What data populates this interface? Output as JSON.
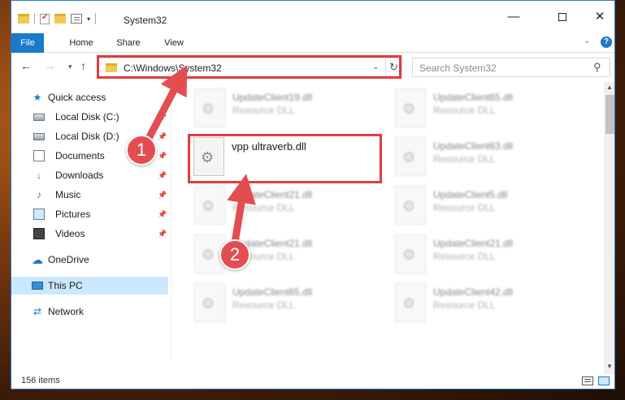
{
  "window": {
    "title": "System32",
    "buttons": {
      "minimize": "—",
      "maximize": "",
      "close": "✕"
    }
  },
  "ribbon": {
    "tabs": [
      "File",
      "Home",
      "Share",
      "View"
    ],
    "expand": "⌄",
    "help": "?"
  },
  "nav": {
    "back": "←",
    "forward": "→",
    "recent": "▾",
    "up": "↑",
    "address": "C:\\Windows\\System32",
    "address_dropdown": "⌄",
    "refresh": "↻",
    "search_placeholder": "Search System32",
    "search_icon": "⚲"
  },
  "sidebar": {
    "items": [
      {
        "label": "Quick access",
        "icon": "star-icon",
        "glyph": "★",
        "pinned": false
      },
      {
        "label": "Local Disk (C:)",
        "icon": "drive-icon",
        "glyph": "",
        "pinned": true
      },
      {
        "label": "Local Disk (D:)",
        "icon": "drive-icon",
        "glyph": "",
        "pinned": true
      },
      {
        "label": "Documents",
        "icon": "document-icon",
        "glyph": "",
        "pinned": true
      },
      {
        "label": "Downloads",
        "icon": "download-icon",
        "glyph": "↓",
        "pinned": true
      },
      {
        "label": "Music",
        "icon": "music-icon",
        "glyph": "♪",
        "pinned": true
      },
      {
        "label": "Pictures",
        "icon": "pictures-icon",
        "glyph": "",
        "pinned": true
      },
      {
        "label": "Videos",
        "icon": "video-icon",
        "glyph": "",
        "pinned": true
      },
      {
        "label": "OneDrive",
        "icon": "cloud-icon",
        "glyph": "☁",
        "pinned": false
      },
      {
        "label": "This PC",
        "icon": "computer-icon",
        "glyph": "",
        "pinned": false
      },
      {
        "label": "Network",
        "icon": "network-icon",
        "glyph": "⇄",
        "pinned": false
      }
    ],
    "pin_glyph": "📌"
  },
  "files": [
    {
      "name": "UpdateClient19.dll",
      "type": "Resource DLL"
    },
    {
      "name": "UpdateClient65.dll",
      "type": "Resource DLL"
    },
    {
      "name": "vpp ultraverb.dll",
      "type": ""
    },
    {
      "name": "UpdateClient63.dll",
      "type": "Resource DLL"
    },
    {
      "name": "UpdateClient21.dll",
      "type": "Resource DLL"
    },
    {
      "name": "UpdateClient5.dll",
      "type": "Resource DLL"
    },
    {
      "name": "UpdateClient21.dll",
      "type": "Resource DLL"
    },
    {
      "name": "UpdateClient21.dll",
      "type": "Resource DLL"
    },
    {
      "name": "UpdateClient65.dll",
      "type": "Resource DLL"
    },
    {
      "name": "UpdateClient42.dll",
      "type": "Resource DLL"
    }
  ],
  "gear_glyph": "⚙",
  "status": {
    "item_count": "156 items"
  },
  "annotations": {
    "badge1": "1",
    "badge2": "2"
  },
  "colors": {
    "accent": "#1979ca",
    "highlight_red": "#e53a40",
    "selected": "#cce8ff"
  }
}
